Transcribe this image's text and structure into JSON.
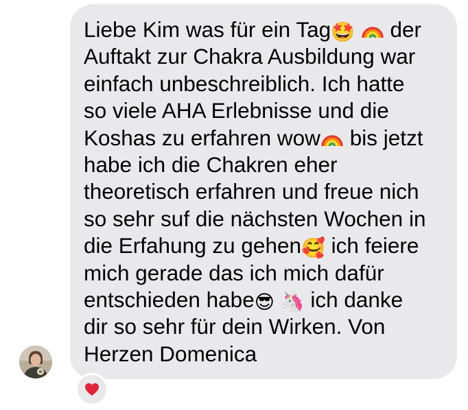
{
  "message": {
    "lines": [
      [
        "Liebe Kim was für ein Tag",
        " der"
      ],
      "Auftakt zur Chakra Ausbildung war",
      "einfach unbeschreiblich. Ich hatte",
      "so viele AHA Erlebnisse und die",
      [
        "Koshas zu erfahren wow",
        " bis jetzt"
      ],
      "habe ich die Chakren eher",
      "theoretisch erfahren und freue nich",
      "so sehr suf die nächsten Wochen in",
      [
        "die Erfahung zu gehen",
        " ich feiere"
      ],
      "mich gerade das ich mich dafür",
      [
        "entschieden habe",
        " ",
        " ich danke"
      ],
      "dir so sehr für dein Wirken. Von",
      "Herzen Domenica"
    ],
    "emojis": {
      "star_struck": "🤩",
      "smiling_hearts": "🥰",
      "sunglasses": "😎",
      "unicorn": "🦄"
    },
    "icons": [
      "rainbow-icon",
      "heart-icon"
    ],
    "colors": {
      "bubble": "#e9e9eb",
      "text": "#000000",
      "heart": "#e0243a"
    }
  }
}
